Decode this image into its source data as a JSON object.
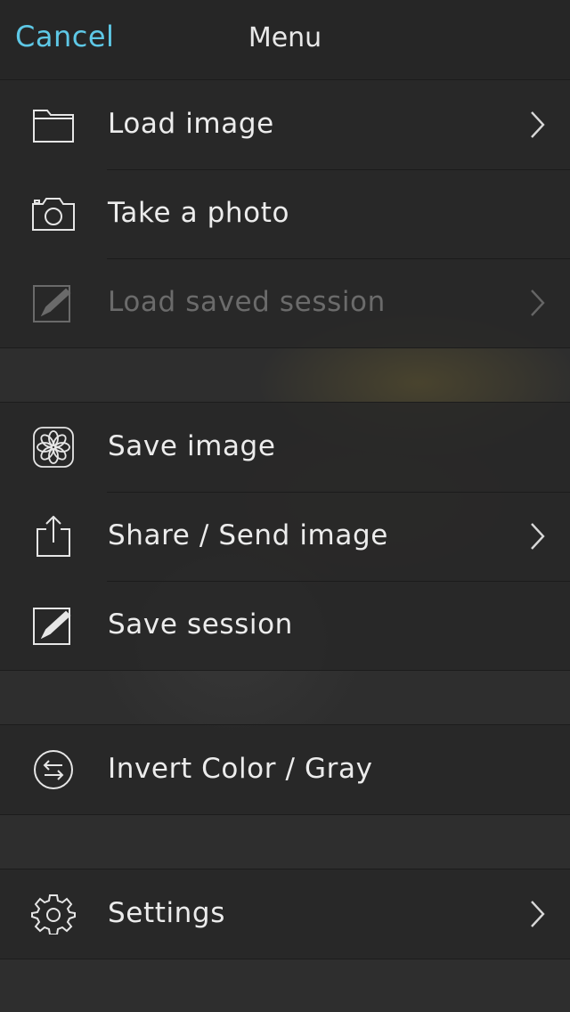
{
  "navbar": {
    "cancel_label": "Cancel",
    "title": "Menu",
    "accent_color": "#5ec8e6"
  },
  "groups": [
    {
      "items": [
        {
          "label": "Load image",
          "icon": "folder-icon",
          "chevron": true,
          "enabled": true
        },
        {
          "label": "Take a photo",
          "icon": "camera-icon",
          "chevron": false,
          "enabled": true
        },
        {
          "label": "Load saved session",
          "icon": "edit-session-icon",
          "chevron": true,
          "enabled": false
        }
      ]
    },
    {
      "items": [
        {
          "label": "Save image",
          "icon": "flower-icon",
          "chevron": false,
          "enabled": true
        },
        {
          "label": "Share / Send image",
          "icon": "share-icon",
          "chevron": true,
          "enabled": true
        },
        {
          "label": "Save session",
          "icon": "edit-session-icon",
          "chevron": false,
          "enabled": true
        }
      ]
    },
    {
      "items": [
        {
          "label": "Invert Color / Gray",
          "icon": "swap-arrows-icon",
          "chevron": false,
          "enabled": true
        }
      ]
    },
    {
      "items": [
        {
          "label": "Settings",
          "icon": "gear-icon",
          "chevron": true,
          "enabled": true
        }
      ]
    }
  ]
}
